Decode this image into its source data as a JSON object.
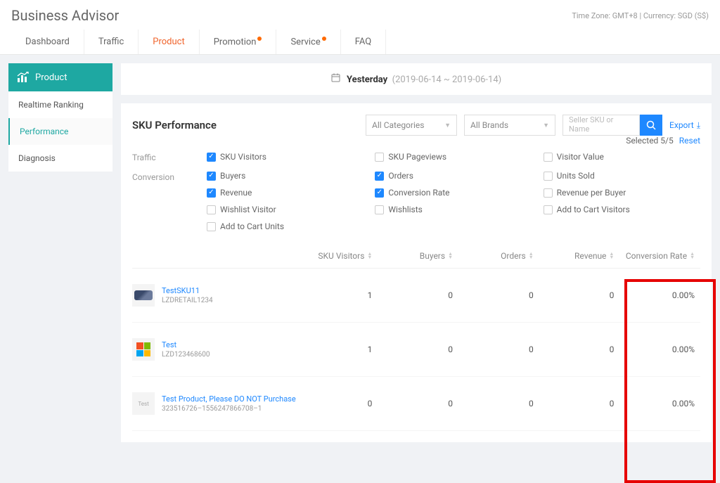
{
  "header": {
    "title": "Business Advisor",
    "top_info": "Time Zone: GMT+8 | Currency: SGD (S$)"
  },
  "tabs": [
    {
      "label": "Dashboard",
      "active": false,
      "dot": false
    },
    {
      "label": "Traffic",
      "active": false,
      "dot": false
    },
    {
      "label": "Product",
      "active": true,
      "dot": false
    },
    {
      "label": "Promotion",
      "active": false,
      "dot": true
    },
    {
      "label": "Service",
      "active": false,
      "dot": true
    },
    {
      "label": "FAQ",
      "active": false,
      "dot": false
    }
  ],
  "sidebar": {
    "header": "Product",
    "items": [
      {
        "label": "Realtime Ranking",
        "active": false
      },
      {
        "label": "Performance",
        "active": true
      },
      {
        "label": "Diagnosis",
        "active": false
      }
    ]
  },
  "date_bar": {
    "label": "Yesterday",
    "range": "(2019-06-14 ~ 2019-06-14)"
  },
  "panel": {
    "title": "SKU Performance",
    "categories": "All Categories",
    "brands": "All Brands",
    "search_placeholder": "Seller SKU or Name",
    "export": "Export"
  },
  "metrics": {
    "traffic_label": "Traffic",
    "conversion_label": "Conversion",
    "traffic": [
      {
        "label": "SKU Visitors",
        "checked": true
      },
      {
        "label": "SKU Pageviews",
        "checked": false
      },
      {
        "label": "Visitor Value",
        "checked": false
      }
    ],
    "conversion": [
      {
        "label": "Buyers",
        "checked": true
      },
      {
        "label": "Orders",
        "checked": true
      },
      {
        "label": "Units Sold",
        "checked": false
      },
      {
        "label": "Revenue",
        "checked": true
      },
      {
        "label": "Conversion Rate",
        "checked": true
      },
      {
        "label": "Revenue per Buyer",
        "checked": false
      },
      {
        "label": "Wishlist Visitor",
        "checked": false
      },
      {
        "label": "Wishlists",
        "checked": false
      },
      {
        "label": "Add to Cart Visitors",
        "checked": false
      },
      {
        "label": "Add to Cart Units",
        "checked": false
      }
    ],
    "selected": "Selected 5/5",
    "reset": "Reset"
  },
  "table": {
    "columns": [
      "SKU Visitors",
      "Buyers",
      "Orders",
      "Revenue",
      "Conversion Rate"
    ],
    "rows": [
      {
        "name": "TestSKU11",
        "sub": "LZDRETAIL1234",
        "thumb": "shoe",
        "vals": [
          "1",
          "0",
          "0",
          "0",
          "0.00%"
        ]
      },
      {
        "name": "Test",
        "sub": "LZD123468600",
        "thumb": "ms",
        "vals": [
          "1",
          "0",
          "0",
          "0",
          "0.00%"
        ]
      },
      {
        "name": "Test Product, Please DO NOT Purchase",
        "sub": "323516726–1556247866708–1",
        "thumb": "box",
        "vals": [
          "0",
          "0",
          "0",
          "0",
          "0.00%"
        ]
      }
    ]
  }
}
